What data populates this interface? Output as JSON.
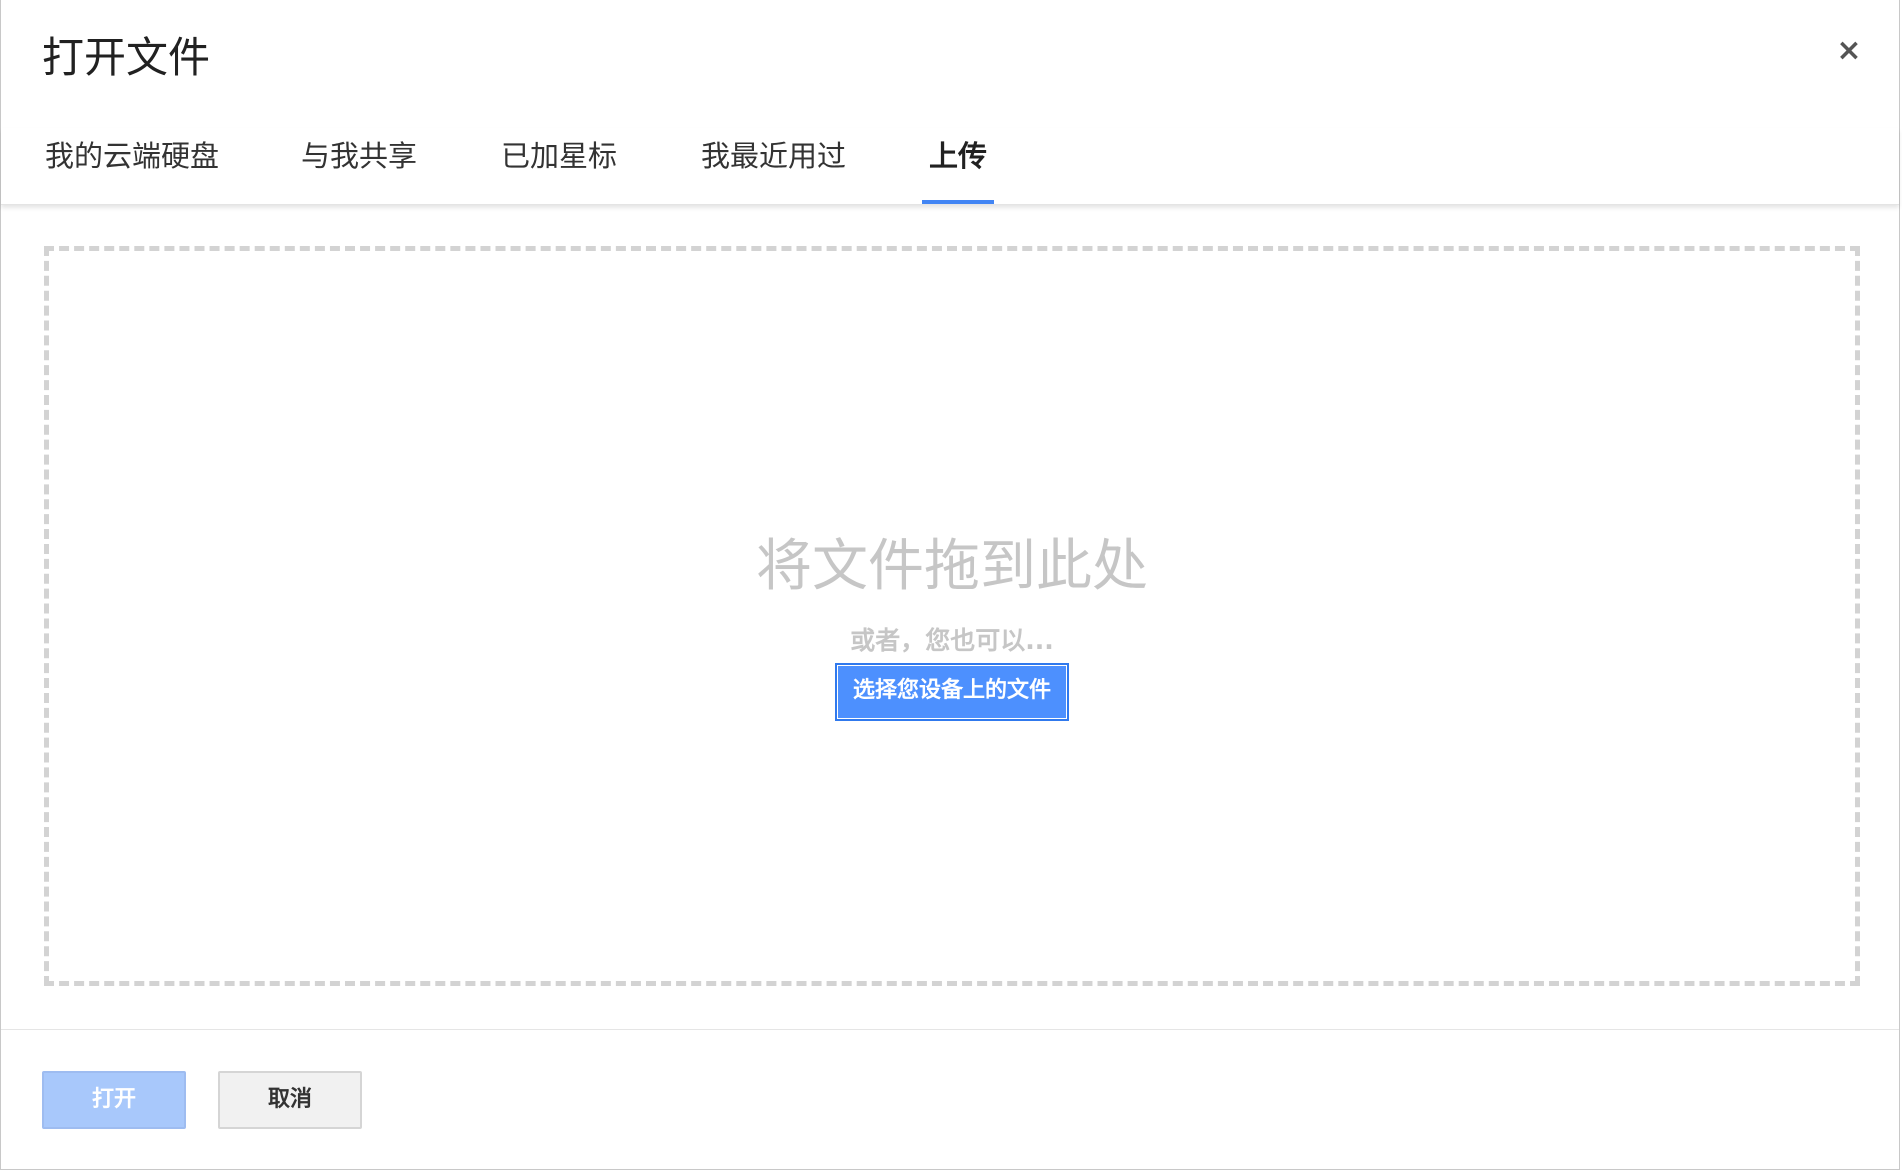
{
  "dialog": {
    "title": "打开文件",
    "close_label": "×"
  },
  "tabs": [
    {
      "label": "我的云端硬盘",
      "active": false
    },
    {
      "label": "与我共享",
      "active": false
    },
    {
      "label": "已加星标",
      "active": false
    },
    {
      "label": "我最近用过",
      "active": false
    },
    {
      "label": "上传",
      "active": true
    }
  ],
  "upload": {
    "drop_text": "将文件拖到此处",
    "or_text": "或者，您也可以...",
    "choose_button": "选择您设备上的文件"
  },
  "footer": {
    "open_button": "打开",
    "cancel_button": "取消"
  },
  "colors": {
    "accent": "#4285f4",
    "primary_button": "#4d90fe",
    "disabled_button": "#a8c8fb"
  }
}
